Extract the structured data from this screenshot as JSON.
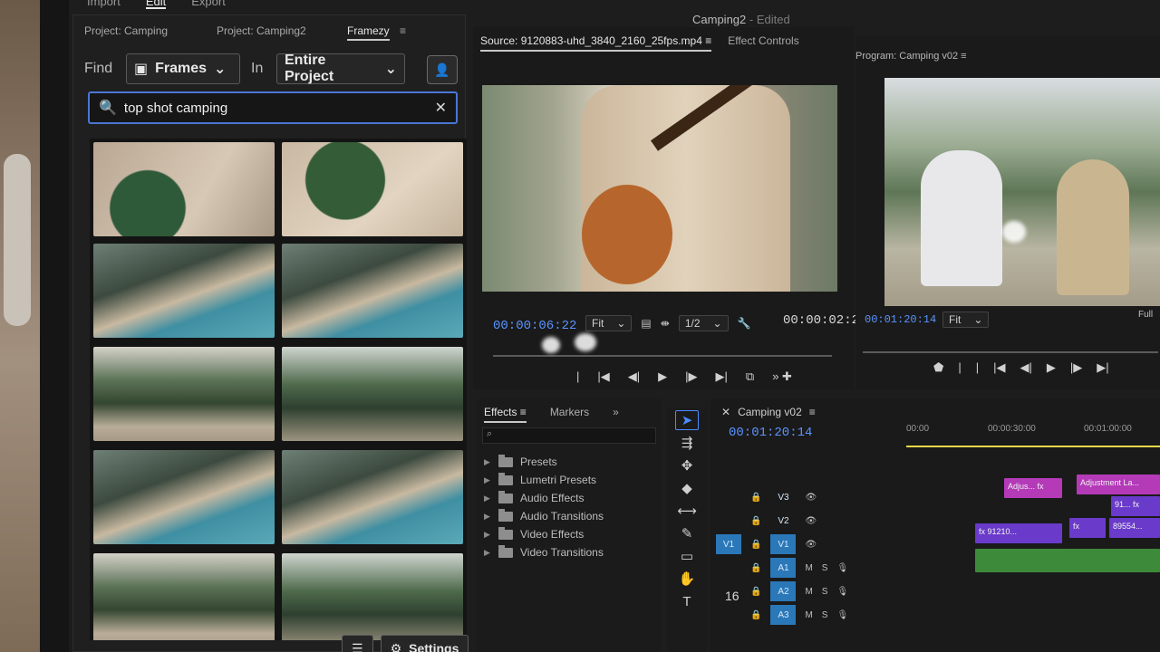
{
  "menu": {
    "items": [
      "Import",
      "Edit",
      "Export"
    ],
    "active": "Edit"
  },
  "sequence_title": {
    "name": "Camping2",
    "state": "- Edited"
  },
  "left_panel": {
    "tabs": [
      "Project: Camping",
      "Project: Camping2",
      "Framezy"
    ],
    "active_tab": "Framezy",
    "find_label": "Find",
    "find_type": "Frames",
    "in_label": "In",
    "scope": "Entire Project",
    "search_value": "top shot camping",
    "settings_label": "Settings"
  },
  "source_monitor": {
    "tab_source": "Source: 9120883-uhd_3840_2160_25fps.mp4",
    "tab_effect_controls": "Effect Controls",
    "timecode_in": "00:00:06:22",
    "fit": "Fit",
    "resolution": "1/2",
    "timecode_out": "00:00:02:2"
  },
  "program_monitor": {
    "tab": "Program: Camping v02",
    "timecode": "00:01:20:14",
    "fit": "Fit",
    "resolution": "Full"
  },
  "effects_panel": {
    "tabs": [
      "Effects",
      "Markers"
    ],
    "active_tab": "Effects",
    "items": [
      "Presets",
      "Lumetri Presets",
      "Audio Effects",
      "Audio Transitions",
      "Video Effects",
      "Video Transitions"
    ]
  },
  "timeline": {
    "title": "Camping v02",
    "timecode": "00:01:20:14",
    "ruler": [
      "00:00",
      "00:00:30:00",
      "00:01:00:00"
    ],
    "tracks": [
      "V3",
      "V2",
      "V1",
      "A1",
      "A2",
      "A3"
    ],
    "source_patch": "V1",
    "track_m": "M",
    "track_s": "S",
    "number_display": "16",
    "clips": {
      "adjustment_short": "Adjus...",
      "adjustment_layer": "Adjustment La...",
      "v2_clip": "91...",
      "v1_clip_a": "91210...",
      "v1_clip_b": "89554...",
      "fx": "fx"
    }
  },
  "colors": {
    "accent_blue": "#4a76d6",
    "timecode_blue": "#5a93ff",
    "clip_pink": "#b43ab8",
    "clip_purple": "#6a3acb",
    "clip_green": "#3d8b3a"
  }
}
